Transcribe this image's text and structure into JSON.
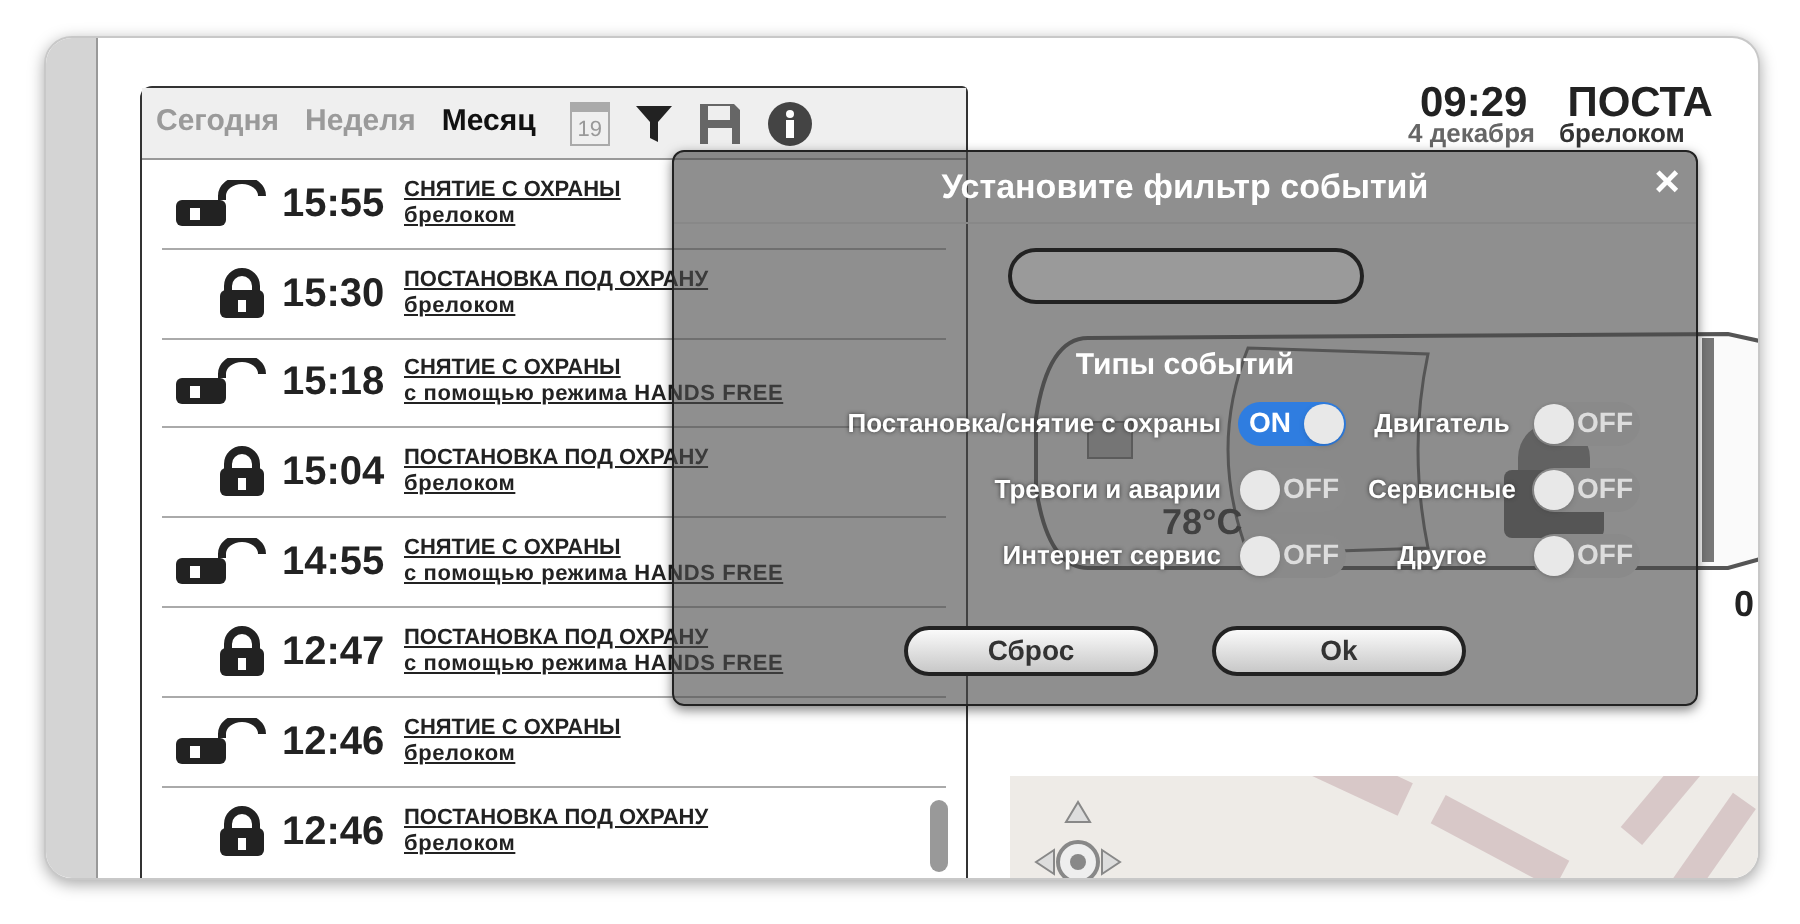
{
  "tabs": [
    {
      "label": "Сегодня",
      "selected": false
    },
    {
      "label": "Неделя",
      "selected": false
    },
    {
      "label": "Месяц",
      "selected": true
    }
  ],
  "calendar_day": "19",
  "events": [
    {
      "kind": "disarm",
      "time": "15:55",
      "title": "СНЯТИЕ С ОХРАНЫ",
      "detail": "брелоком"
    },
    {
      "kind": "arm",
      "time": "15:30",
      "title": "ПОСТАНОВКА ПОД ОХРАНУ",
      "detail": "брелоком"
    },
    {
      "kind": "disarm",
      "time": "15:18",
      "title": "СНЯТИЕ С ОХРАНЫ",
      "detail": "с помощью режима HANDS FREE"
    },
    {
      "kind": "arm",
      "time": "15:04",
      "title": "ПОСТАНОВКА ПОД ОХРАНУ",
      "detail": "брелоком"
    },
    {
      "kind": "disarm",
      "time": "14:55",
      "title": "СНЯТИЕ С ОХРАНЫ",
      "detail": "с помощью режима HANDS FREE"
    },
    {
      "kind": "arm",
      "time": "12:47",
      "title": "ПОСТАНОВКА ПОД ОХРАНУ",
      "detail": "с помощью режима HANDS FREE"
    },
    {
      "kind": "disarm",
      "time": "12:46",
      "title": "СНЯТИЕ С ОХРАНЫ",
      "detail": "брелоком"
    },
    {
      "kind": "arm",
      "time": "12:46",
      "title": "ПОСТАНОВКА ПОД ОХРАНУ",
      "detail": "брелоком"
    }
  ],
  "latest": {
    "time": "09:29",
    "title": "ПОСТА",
    "date": "4 декабря",
    "detail": "брелоком"
  },
  "car": {
    "temperature": "78°C",
    "reading": "0"
  },
  "modal": {
    "title": "Установите фильтр событий",
    "close": "×",
    "section": "Типы событий",
    "filters": [
      {
        "label": "Постановка/снятие с охраны",
        "on": true,
        "switch_text": "ON"
      },
      {
        "label": "Двигатель",
        "on": false,
        "switch_text": "OFF"
      },
      {
        "label": "Тревоги и аварии",
        "on": false,
        "switch_text": "OFF"
      },
      {
        "label": "Сервисные",
        "on": false,
        "switch_text": "OFF"
      },
      {
        "label": "Интернет сервис",
        "on": false,
        "switch_text": "OFF"
      },
      {
        "label": "Другое",
        "on": false,
        "switch_text": "OFF"
      }
    ],
    "buttons": [
      "Сброс",
      "Ok"
    ]
  }
}
